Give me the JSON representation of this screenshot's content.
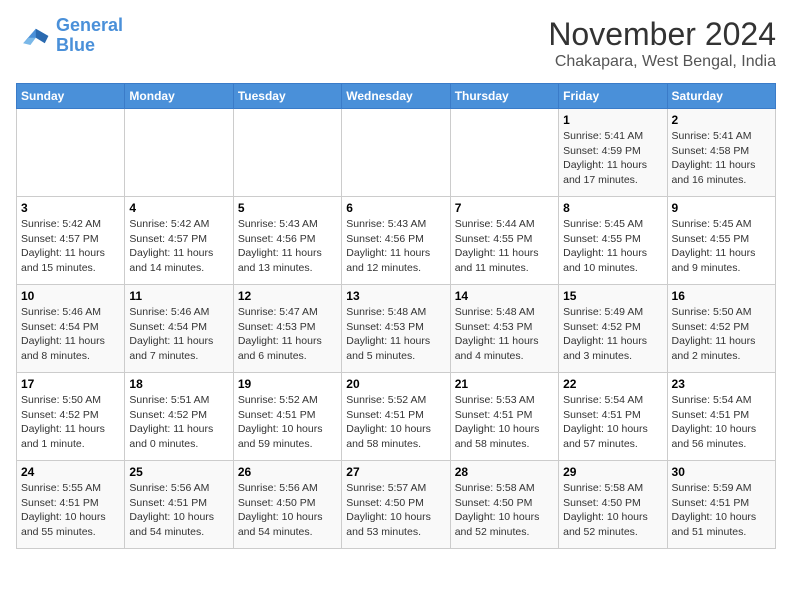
{
  "logo": {
    "line1": "General",
    "line2": "Blue"
  },
  "title": "November 2024",
  "subtitle": "Chakapara, West Bengal, India",
  "days_header": [
    "Sunday",
    "Monday",
    "Tuesday",
    "Wednesday",
    "Thursday",
    "Friday",
    "Saturday"
  ],
  "weeks": [
    [
      {
        "day": "",
        "info": ""
      },
      {
        "day": "",
        "info": ""
      },
      {
        "day": "",
        "info": ""
      },
      {
        "day": "",
        "info": ""
      },
      {
        "day": "",
        "info": ""
      },
      {
        "day": "1",
        "info": "Sunrise: 5:41 AM\nSunset: 4:59 PM\nDaylight: 11 hours and 17 minutes."
      },
      {
        "day": "2",
        "info": "Sunrise: 5:41 AM\nSunset: 4:58 PM\nDaylight: 11 hours and 16 minutes."
      }
    ],
    [
      {
        "day": "3",
        "info": "Sunrise: 5:42 AM\nSunset: 4:57 PM\nDaylight: 11 hours and 15 minutes."
      },
      {
        "day": "4",
        "info": "Sunrise: 5:42 AM\nSunset: 4:57 PM\nDaylight: 11 hours and 14 minutes."
      },
      {
        "day": "5",
        "info": "Sunrise: 5:43 AM\nSunset: 4:56 PM\nDaylight: 11 hours and 13 minutes."
      },
      {
        "day": "6",
        "info": "Sunrise: 5:43 AM\nSunset: 4:56 PM\nDaylight: 11 hours and 12 minutes."
      },
      {
        "day": "7",
        "info": "Sunrise: 5:44 AM\nSunset: 4:55 PM\nDaylight: 11 hours and 11 minutes."
      },
      {
        "day": "8",
        "info": "Sunrise: 5:45 AM\nSunset: 4:55 PM\nDaylight: 11 hours and 10 minutes."
      },
      {
        "day": "9",
        "info": "Sunrise: 5:45 AM\nSunset: 4:55 PM\nDaylight: 11 hours and 9 minutes."
      }
    ],
    [
      {
        "day": "10",
        "info": "Sunrise: 5:46 AM\nSunset: 4:54 PM\nDaylight: 11 hours and 8 minutes."
      },
      {
        "day": "11",
        "info": "Sunrise: 5:46 AM\nSunset: 4:54 PM\nDaylight: 11 hours and 7 minutes."
      },
      {
        "day": "12",
        "info": "Sunrise: 5:47 AM\nSunset: 4:53 PM\nDaylight: 11 hours and 6 minutes."
      },
      {
        "day": "13",
        "info": "Sunrise: 5:48 AM\nSunset: 4:53 PM\nDaylight: 11 hours and 5 minutes."
      },
      {
        "day": "14",
        "info": "Sunrise: 5:48 AM\nSunset: 4:53 PM\nDaylight: 11 hours and 4 minutes."
      },
      {
        "day": "15",
        "info": "Sunrise: 5:49 AM\nSunset: 4:52 PM\nDaylight: 11 hours and 3 minutes."
      },
      {
        "day": "16",
        "info": "Sunrise: 5:50 AM\nSunset: 4:52 PM\nDaylight: 11 hours and 2 minutes."
      }
    ],
    [
      {
        "day": "17",
        "info": "Sunrise: 5:50 AM\nSunset: 4:52 PM\nDaylight: 11 hours and 1 minute."
      },
      {
        "day": "18",
        "info": "Sunrise: 5:51 AM\nSunset: 4:52 PM\nDaylight: 11 hours and 0 minutes."
      },
      {
        "day": "19",
        "info": "Sunrise: 5:52 AM\nSunset: 4:51 PM\nDaylight: 10 hours and 59 minutes."
      },
      {
        "day": "20",
        "info": "Sunrise: 5:52 AM\nSunset: 4:51 PM\nDaylight: 10 hours and 58 minutes."
      },
      {
        "day": "21",
        "info": "Sunrise: 5:53 AM\nSunset: 4:51 PM\nDaylight: 10 hours and 58 minutes."
      },
      {
        "day": "22",
        "info": "Sunrise: 5:54 AM\nSunset: 4:51 PM\nDaylight: 10 hours and 57 minutes."
      },
      {
        "day": "23",
        "info": "Sunrise: 5:54 AM\nSunset: 4:51 PM\nDaylight: 10 hours and 56 minutes."
      }
    ],
    [
      {
        "day": "24",
        "info": "Sunrise: 5:55 AM\nSunset: 4:51 PM\nDaylight: 10 hours and 55 minutes."
      },
      {
        "day": "25",
        "info": "Sunrise: 5:56 AM\nSunset: 4:51 PM\nDaylight: 10 hours and 54 minutes."
      },
      {
        "day": "26",
        "info": "Sunrise: 5:56 AM\nSunset: 4:50 PM\nDaylight: 10 hours and 54 minutes."
      },
      {
        "day": "27",
        "info": "Sunrise: 5:57 AM\nSunset: 4:50 PM\nDaylight: 10 hours and 53 minutes."
      },
      {
        "day": "28",
        "info": "Sunrise: 5:58 AM\nSunset: 4:50 PM\nDaylight: 10 hours and 52 minutes."
      },
      {
        "day": "29",
        "info": "Sunrise: 5:58 AM\nSunset: 4:50 PM\nDaylight: 10 hours and 52 minutes."
      },
      {
        "day": "30",
        "info": "Sunrise: 5:59 AM\nSunset: 4:51 PM\nDaylight: 10 hours and 51 minutes."
      }
    ]
  ]
}
